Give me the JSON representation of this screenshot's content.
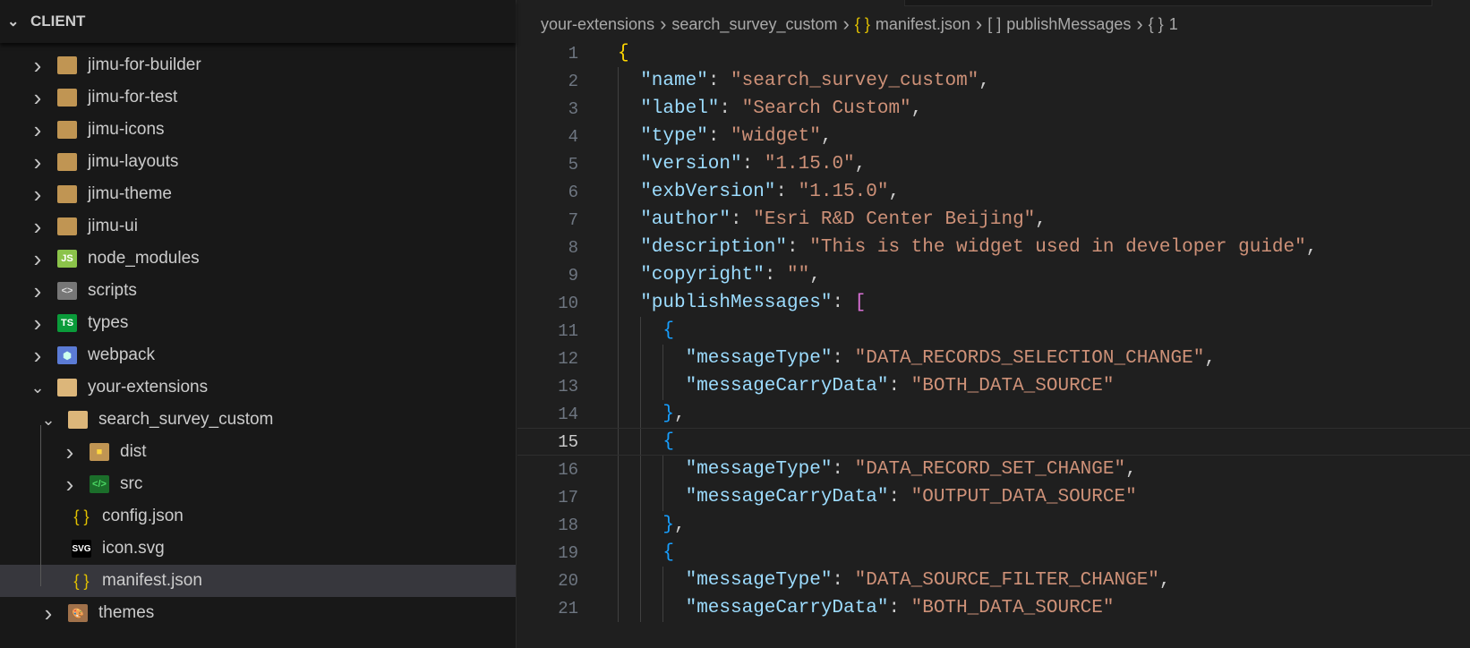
{
  "explorer": {
    "section": "CLIENT",
    "items": [
      {
        "label": "jimu-for-builder",
        "icon": "folder",
        "expanded": false,
        "depth": 0
      },
      {
        "label": "jimu-for-test",
        "icon": "folder",
        "expanded": false,
        "depth": 0
      },
      {
        "label": "jimu-icons",
        "icon": "folder",
        "expanded": false,
        "depth": 0
      },
      {
        "label": "jimu-layouts",
        "icon": "folder",
        "expanded": false,
        "depth": 0
      },
      {
        "label": "jimu-theme",
        "icon": "folder",
        "expanded": false,
        "depth": 0
      },
      {
        "label": "jimu-ui",
        "icon": "folder",
        "expanded": false,
        "depth": 0
      },
      {
        "label": "node_modules",
        "icon": "node-folder",
        "badge": "JS",
        "expanded": false,
        "depth": 0
      },
      {
        "label": "scripts",
        "icon": "scripts-folder",
        "badge": "<>",
        "expanded": false,
        "depth": 0
      },
      {
        "label": "types",
        "icon": "ts-folder",
        "badge": "TS",
        "expanded": false,
        "depth": 0
      },
      {
        "label": "webpack",
        "icon": "webpack-folder",
        "badge": "⬢",
        "expanded": false,
        "depth": 0
      },
      {
        "label": "your-extensions",
        "icon": "folder-open",
        "expanded": true,
        "depth": 0
      },
      {
        "label": "search_survey_custom",
        "icon": "folder-open",
        "expanded": true,
        "depth": 1
      },
      {
        "label": "dist",
        "icon": "dist-folder",
        "badge": "■",
        "expanded": false,
        "depth": 2
      },
      {
        "label": "src",
        "icon": "src-folder",
        "badge": "</>",
        "expanded": false,
        "depth": 2
      },
      {
        "label": "config.json",
        "icon": "json-file",
        "badge": "{ }",
        "depth": 2
      },
      {
        "label": "icon.svg",
        "icon": "svg-file",
        "badge": "SVG",
        "depth": 2
      },
      {
        "label": "manifest.json",
        "icon": "json-file",
        "badge": "{ }",
        "depth": 2,
        "selected": true
      },
      {
        "label": "themes",
        "icon": "themes-folder",
        "badge": "🎨",
        "expanded": false,
        "depth": 1
      }
    ]
  },
  "breadcrumb": {
    "items": [
      "your-extensions",
      "search_survey_custom",
      "{ }",
      "manifest.json",
      "[ ]",
      "publishMessages",
      "{ }",
      "1"
    ]
  },
  "editor": {
    "current_line": 15,
    "lines": [
      [
        [
          "b1",
          "{"
        ]
      ],
      [
        [
          "k",
          "\"name\""
        ],
        [
          "p",
          ": "
        ],
        [
          "s",
          "\"search_survey_custom\""
        ],
        [
          "p",
          ","
        ]
      ],
      [
        [
          "k",
          "\"label\""
        ],
        [
          "p",
          ": "
        ],
        [
          "s",
          "\"Search Custom\""
        ],
        [
          "p",
          ","
        ]
      ],
      [
        [
          "k",
          "\"type\""
        ],
        [
          "p",
          ": "
        ],
        [
          "s",
          "\"widget\""
        ],
        [
          "p",
          ","
        ]
      ],
      [
        [
          "k",
          "\"version\""
        ],
        [
          "p",
          ": "
        ],
        [
          "s",
          "\"1.15.0\""
        ],
        [
          "p",
          ","
        ]
      ],
      [
        [
          "k",
          "\"exbVersion\""
        ],
        [
          "p",
          ": "
        ],
        [
          "s",
          "\"1.15.0\""
        ],
        [
          "p",
          ","
        ]
      ],
      [
        [
          "k",
          "\"author\""
        ],
        [
          "p",
          ": "
        ],
        [
          "s",
          "\"Esri R&D Center Beijing\""
        ],
        [
          "p",
          ","
        ]
      ],
      [
        [
          "k",
          "\"description\""
        ],
        [
          "p",
          ": "
        ],
        [
          "s",
          "\"This is the widget used in developer guide\""
        ],
        [
          "p",
          ","
        ]
      ],
      [
        [
          "k",
          "\"copyright\""
        ],
        [
          "p",
          ": "
        ],
        [
          "s",
          "\"\""
        ],
        [
          "p",
          ","
        ]
      ],
      [
        [
          "k",
          "\"publishMessages\""
        ],
        [
          "p",
          ": "
        ],
        [
          "b2",
          "["
        ]
      ],
      [
        [
          "b3",
          "{"
        ]
      ],
      [
        [
          "k",
          "\"messageType\""
        ],
        [
          "p",
          ": "
        ],
        [
          "s",
          "\"DATA_RECORDS_SELECTION_CHANGE\""
        ],
        [
          "p",
          ","
        ]
      ],
      [
        [
          "k",
          "\"messageCarryData\""
        ],
        [
          "p",
          ": "
        ],
        [
          "s",
          "\"BOTH_DATA_SOURCE\""
        ]
      ],
      [
        [
          "b3",
          "}"
        ],
        [
          "p",
          ","
        ]
      ],
      [
        [
          "b3",
          "{"
        ]
      ],
      [
        [
          "k",
          "\"messageType\""
        ],
        [
          "p",
          ": "
        ],
        [
          "s",
          "\"DATA_RECORD_SET_CHANGE\""
        ],
        [
          "p",
          ","
        ]
      ],
      [
        [
          "k",
          "\"messageCarryData\""
        ],
        [
          "p",
          ": "
        ],
        [
          "s",
          "\"OUTPUT_DATA_SOURCE\""
        ]
      ],
      [
        [
          "b3",
          "}"
        ],
        [
          "p",
          ","
        ]
      ],
      [
        [
          "b3",
          "{"
        ]
      ],
      [
        [
          "k",
          "\"messageType\""
        ],
        [
          "p",
          ": "
        ],
        [
          "s",
          "\"DATA_SOURCE_FILTER_CHANGE\""
        ],
        [
          "p",
          ","
        ]
      ],
      [
        [
          "k",
          "\"messageCarryData\""
        ],
        [
          "p",
          ": "
        ],
        [
          "s",
          "\"BOTH_DATA_SOURCE\""
        ]
      ]
    ],
    "indents": [
      0,
      1,
      1,
      1,
      1,
      1,
      1,
      1,
      1,
      1,
      2,
      3,
      3,
      2,
      2,
      3,
      3,
      2,
      2,
      3,
      3
    ]
  }
}
